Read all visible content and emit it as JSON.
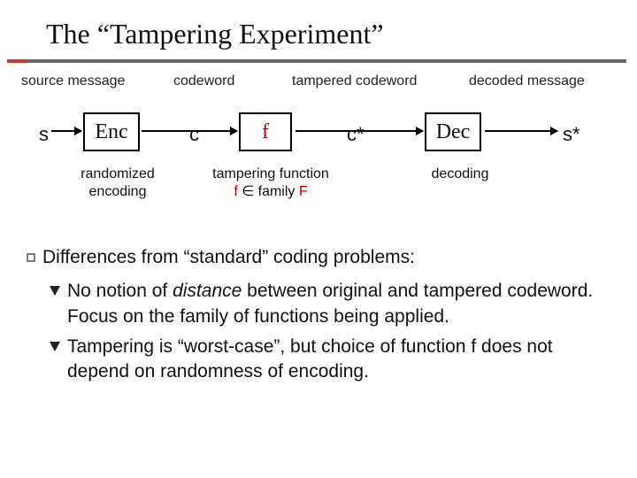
{
  "title": "The “Tampering Experiment”",
  "headers": {
    "source": "source message",
    "codeword": "codeword",
    "tampered": "tampered codeword",
    "decoded": "decoded message"
  },
  "symbols": {
    "s": "s",
    "c": "c",
    "cstar": "c*",
    "sstar": "s*"
  },
  "boxes": {
    "enc": "Enc",
    "f": "f",
    "dec": "Dec"
  },
  "subs": {
    "enc_l1": "randomized",
    "enc_l2": "encoding",
    "f_l1": "tampering function",
    "f_l2_a": "f",
    "f_l2_b": " ∈ family ",
    "f_l2_c": "F",
    "dec": "decoding"
  },
  "body": {
    "diff": "Differences from “standard” coding problems:",
    "p1_a": "No notion of ",
    "p1_b": "distance",
    "p1_c": " between original and tampered codeword. Focus on the family of functions being applied.",
    "p2": "Tampering is “worst-case”, but choice of function f does not depend on randomness of encoding."
  }
}
